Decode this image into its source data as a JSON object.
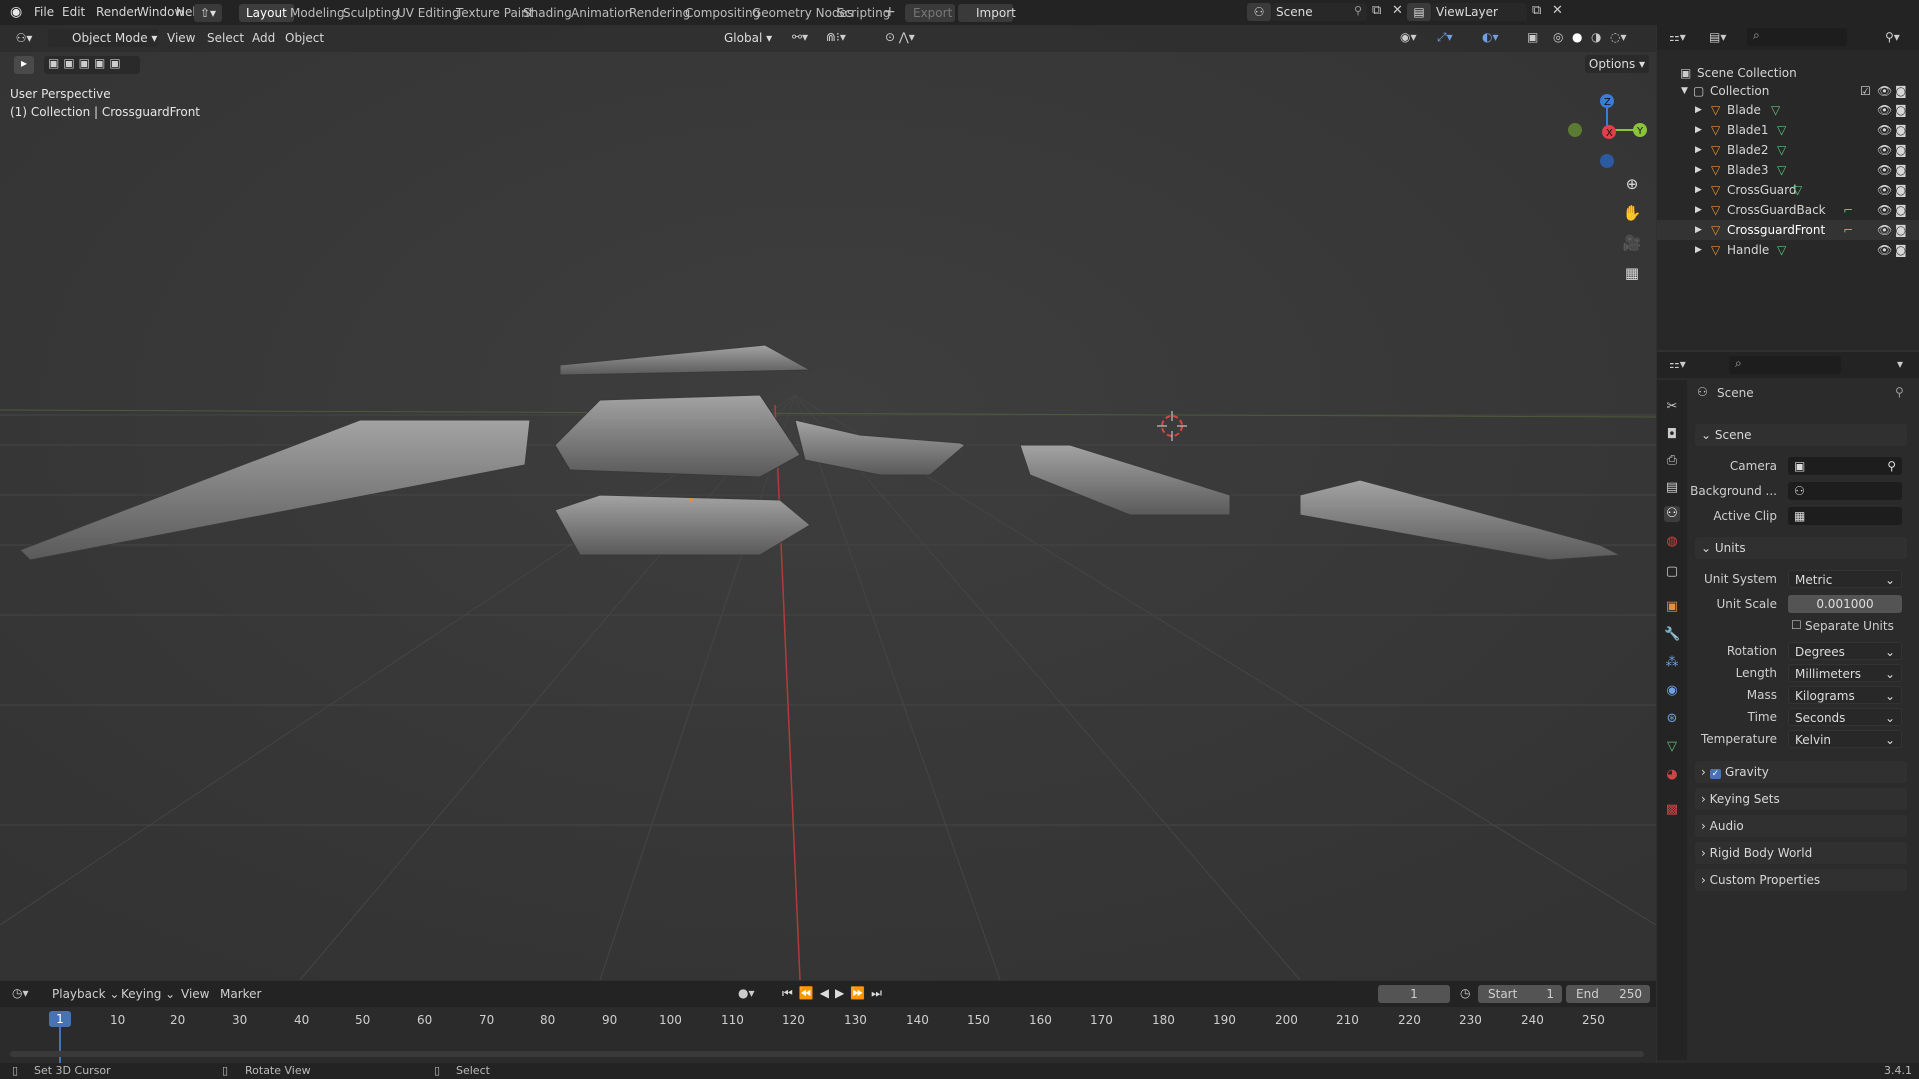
{
  "menu": [
    "File",
    "Edit",
    "Render",
    "Window",
    "Help"
  ],
  "workspaces": [
    "Layout",
    "Modeling",
    "Sculpting",
    "UV Editing",
    "Texture Paint",
    "Shading",
    "Animation",
    "Rendering",
    "Compositing",
    "Geometry Nodes",
    "Scripting"
  ],
  "topbar": {
    "export": "Export",
    "import": "Import",
    "scene": "Scene",
    "view_layer": "ViewLayer"
  },
  "viewport": {
    "mode": "Object Mode",
    "menus": [
      "View",
      "Select",
      "Add",
      "Object"
    ],
    "transform": "Global",
    "options": "Options",
    "overlay_line1": "User Perspective",
    "overlay_line2": "(1) Collection | CrossguardFront",
    "axis": {
      "x": "X",
      "y": "Y",
      "z": "Z"
    }
  },
  "outliner": {
    "scene_collection": "Scene Collection",
    "collection": "Collection",
    "items": [
      "Blade",
      "Blade1",
      "Blade2",
      "Blade3",
      "CrossGuard",
      "CrossGuardBack",
      "CrossguardFront",
      "Handle"
    ]
  },
  "properties": {
    "context": "Scene",
    "scene_section": "Scene",
    "camera_label": "Camera",
    "background_label": "Background ...",
    "active_clip_label": "Active Clip",
    "units_section": "Units",
    "unit_system_label": "Unit System",
    "unit_system": "Metric",
    "unit_scale_label": "Unit Scale",
    "unit_scale": "0.001000",
    "separate_units": "Separate Units",
    "rotation_label": "Rotation",
    "rotation": "Degrees",
    "length_label": "Length",
    "length": "Millimeters",
    "mass_label": "Mass",
    "mass": "Kilograms",
    "time_label": "Time",
    "time": "Seconds",
    "temperature_label": "Temperature",
    "temperature": "Kelvin",
    "sections": [
      "Gravity",
      "Keying Sets",
      "Audio",
      "Rigid Body World",
      "Custom Properties"
    ]
  },
  "timeline": {
    "menus": [
      "Playback",
      "Keying",
      "View",
      "Marker"
    ],
    "current_frame": "1",
    "start_label": "Start",
    "start": "1",
    "end_label": "End",
    "end": "250",
    "ticks": [
      "10",
      "20",
      "30",
      "40",
      "50",
      "60",
      "70",
      "80",
      "90",
      "100",
      "110",
      "120",
      "130",
      "140",
      "150",
      "160",
      "170",
      "180",
      "190",
      "200",
      "210",
      "220",
      "230",
      "240",
      "250"
    ],
    "playhead": "1"
  },
  "status": {
    "left": "Set 3D Cursor",
    "mid": "Rotate View",
    "right": "Select",
    "version": "3.4.1"
  },
  "colors": {
    "accent": "#4772b3",
    "x_axis": "#e0404a",
    "y_axis": "#8bc43a",
    "z_axis": "#3b7bd9",
    "object_orange": "#e3903a",
    "mesh_green": "#5fc47c"
  }
}
